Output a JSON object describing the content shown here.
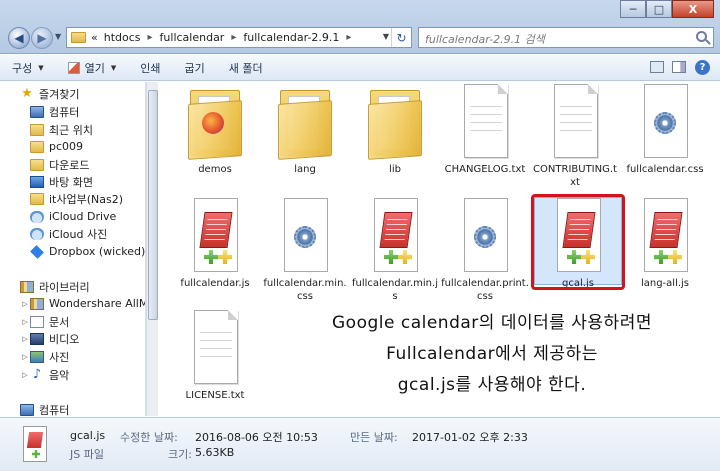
{
  "window": {
    "title": "fullcalendar-2.9.1",
    "controls": {
      "minimize": "─",
      "maximize": "□",
      "close": "X"
    }
  },
  "address": {
    "overflow": "«",
    "crumbs": [
      "htdocs",
      "fullcalendar",
      "fullcalendar-2.9.1"
    ]
  },
  "search": {
    "placeholder": "fullcalendar-2.9.1 검색"
  },
  "toolbar": {
    "organize": "구성",
    "open": "열기",
    "print": "인쇄",
    "burn": "굽기",
    "new_folder": "새 폴더",
    "help": "?"
  },
  "sidebar": {
    "favorites": "즐겨찾기",
    "items": [
      "컴퓨터",
      "최근 위치",
      "pc009",
      "다운로드",
      "바탕 화면",
      "it사업부(Nas2)",
      "iCloud Drive",
      "iCloud 사진",
      "Dropbox (wicked)"
    ],
    "libraries": "라이브러리",
    "library_items": [
      "Wondershare AllMyTu",
      "문서",
      "비디오",
      "사진",
      "음악"
    ],
    "computer": "컴퓨터"
  },
  "files": [
    {
      "name": "demos",
      "type": "folder"
    },
    {
      "name": "lang",
      "type": "folder"
    },
    {
      "name": "lib",
      "type": "folder"
    },
    {
      "name": "CHANGELOG.txt",
      "type": "txt"
    },
    {
      "name": "CONTRIBUTING.txt",
      "type": "txt"
    },
    {
      "name": "fullcalendar.css",
      "type": "css"
    },
    {
      "name": "fullcalendar.js",
      "type": "js"
    },
    {
      "name": "fullcalendar.min.css",
      "type": "css"
    },
    {
      "name": "fullcalendar.min.js",
      "type": "js"
    },
    {
      "name": "fullcalendar.print.css",
      "type": "css"
    },
    {
      "name": "gcal.js",
      "type": "js",
      "selected": true
    },
    {
      "name": "lang-all.js",
      "type": "js"
    },
    {
      "name": "LICENSE.txt",
      "type": "txt"
    }
  ],
  "annotation": {
    "line1": "Google calendar의 데이터를 사용하려면",
    "line2": "Fullcalendar에서 제공하는",
    "line3": "gcal.js를 사용해야 한다."
  },
  "details": {
    "name": "gcal.js",
    "type": "JS 파일",
    "modified_label": "수정한 날짜:",
    "modified": "2016-08-06 오전 10:53",
    "created_label": "만든 날짜:",
    "created": "2017-01-02 오후 2:33",
    "size_label": "크기:",
    "size": "5.63KB"
  },
  "colors": {
    "highlight_border": "#d4141c",
    "selection": "#d4e6fb"
  }
}
